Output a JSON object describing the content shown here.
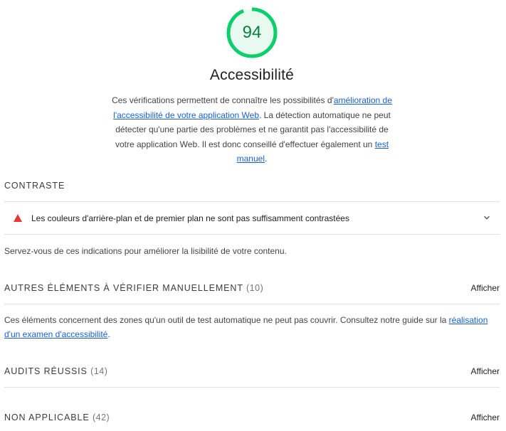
{
  "score": {
    "value": "94",
    "fraction": 0.94,
    "color": "#0cce6b"
  },
  "category": {
    "title": "Accessibilité",
    "description_before": "Ces vérifications permettent de connaître les possibilités d'",
    "link1": "amélioration de l'accessibilité de votre application Web",
    "description_middle": ". La détection automatique ne peut détecter qu'une partie des problèmes et ne garantit pas l'accessibilité de votre application Web. Il est donc conseillé d'effectuer également un ",
    "link2": "test manuel",
    "description_end": "."
  },
  "contrast": {
    "label": "CONTRASTE",
    "audit_title": "Les couleurs d'arrière-plan et de premier plan ne sont pas suffisamment contrastées",
    "audit_icon": "warning-triangle-icon",
    "note": "Servez-vous de ces indications pour améliorer la lisibilité de votre contenu."
  },
  "manual": {
    "label": "AUTRES ÉLÉMENTS À VÉRIFIER MANUELLEMENT",
    "count": "(10)",
    "show": "Afficher",
    "note_before": "Ces éléments concernent des zones qu'un outil de test automatique ne peut pas couvrir. Consultez notre guide sur la ",
    "note_link": "réalisation d'un examen d'accessibilité",
    "note_end": "."
  },
  "passed": {
    "label": "AUDITS RÉUSSIS",
    "count": "(14)",
    "show": "Afficher"
  },
  "not_applicable": {
    "label": "NON APPLICABLE",
    "count": "(42)",
    "show": "Afficher"
  },
  "colors": {
    "pass": "#0cce6b",
    "fail": "#e53935",
    "link": "#1a5fd6"
  }
}
